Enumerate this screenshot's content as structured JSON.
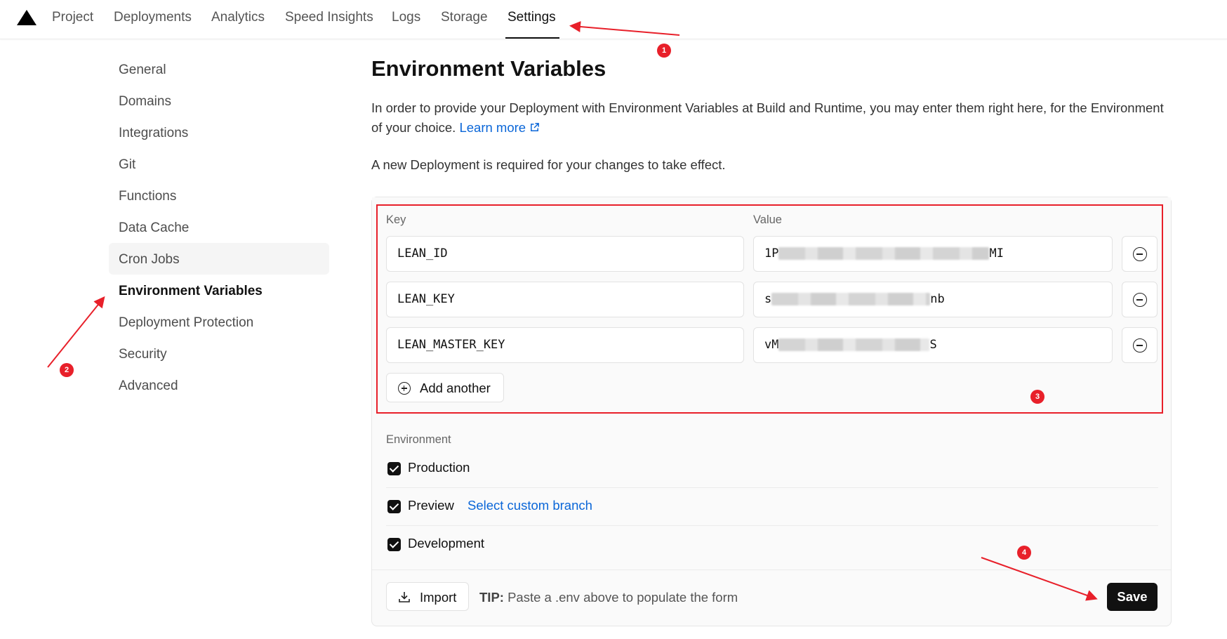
{
  "topnav": {
    "logo_icon": "triangle-logo",
    "tabs": [
      "Project",
      "Deployments",
      "Analytics",
      "Speed Insights",
      "Logs",
      "Storage",
      "Settings"
    ],
    "active_tab": "Settings"
  },
  "sidebar": {
    "items": [
      "General",
      "Domains",
      "Integrations",
      "Git",
      "Functions",
      "Data Cache",
      "Cron Jobs",
      "Environment Variables",
      "Deployment Protection",
      "Security",
      "Advanced"
    ],
    "active_item": "Environment Variables"
  },
  "main": {
    "title": "Environment Variables",
    "description": "In order to provide your Deployment with Environment Variables at Build and Runtime, you may enter them right here, for the Environment of your choice.",
    "learn_more": "Learn more",
    "notice": "A new Deployment is required for your changes to take effect."
  },
  "form": {
    "key_label": "Key",
    "value_label": "Value",
    "rows": [
      {
        "key": "LEAN_ID",
        "value_start": "1P",
        "value_end": "MI"
      },
      {
        "key": "LEAN_KEY",
        "value_start": "s",
        "value_end": "nb"
      },
      {
        "key": "LEAN_MASTER_KEY",
        "value_start": "vM",
        "value_end": "S"
      }
    ],
    "add_another": "Add another",
    "environment_label": "Environment",
    "environments": [
      {
        "name": "Production",
        "checked": true
      },
      {
        "name": "Preview",
        "checked": true,
        "link": "Select custom branch"
      },
      {
        "name": "Development",
        "checked": true
      }
    ]
  },
  "footer": {
    "import": "Import",
    "tip_prefix": "TIP:",
    "tip_text": "Paste a .env above to populate the form",
    "save": "Save"
  },
  "annotations": {
    "color": "#e8202a",
    "markers": [
      "1",
      "2",
      "3",
      "4"
    ]
  }
}
